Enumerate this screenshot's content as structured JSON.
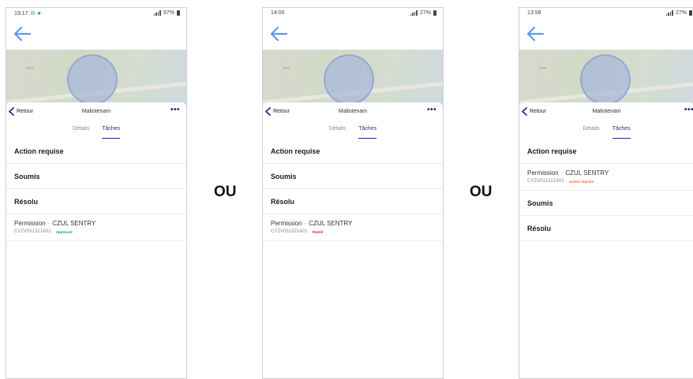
{
  "separator_label": "OU",
  "colors": {
    "accent_blue": "#5b9bf0",
    "dark_nav": "#2a2a80",
    "approved": "#2e9b3e",
    "rejected": "#e02020",
    "action_required": "#ee6a1e"
  },
  "screens": [
    {
      "status": {
        "time": "19:17",
        "extra": "✉ ★",
        "battery": "97%"
      },
      "back_label": "Retour",
      "title": "Maliotenam",
      "menu": "•••",
      "tabs": [
        "Détails",
        "Tâches"
      ],
      "active_tab": "Tâches",
      "sections": [
        "Action requise",
        "Soumis",
        "Résolu"
      ],
      "items": [
        {
          "title": "Permission",
          "separator": "·",
          "org": "CZUL SENTRY",
          "code": "CYZV051321A02",
          "badge": "Approuvé",
          "badge_color": "#2e9b3e",
          "under": "Résolu"
        }
      ]
    },
    {
      "status": {
        "time": "14:00",
        "extra": "",
        "battery": "27%"
      },
      "back_label": "Retour",
      "title": "Maliotenam",
      "menu": "•••",
      "tabs": [
        "Détails",
        "Tâches"
      ],
      "active_tab": "Tâches",
      "sections": [
        "Action requise",
        "Soumis",
        "Résolu"
      ],
      "items": [
        {
          "title": "Permission",
          "separator": "·",
          "org": "CZUL SENTRY",
          "code": "CYZV031321A01",
          "badge": "Rejeté",
          "badge_color": "#e02020",
          "under": "Résolu"
        }
      ]
    },
    {
      "status": {
        "time": "13:58",
        "extra": "",
        "battery": "27%"
      },
      "back_label": "Retour",
      "title": "Maliotenam",
      "menu": "•••",
      "tabs": [
        "Détails",
        "Tâches"
      ],
      "active_tab": "Tâches",
      "sections": [
        "Action requise",
        "Soumis",
        "Résolu"
      ],
      "items": [
        {
          "title": "Permission",
          "separator": "·",
          "org": "CZUL SENTRY",
          "code": "CYZV031321A01",
          "badge": "Action requise",
          "badge_color": "#ee6a1e",
          "under": "Action requise"
        }
      ]
    }
  ]
}
